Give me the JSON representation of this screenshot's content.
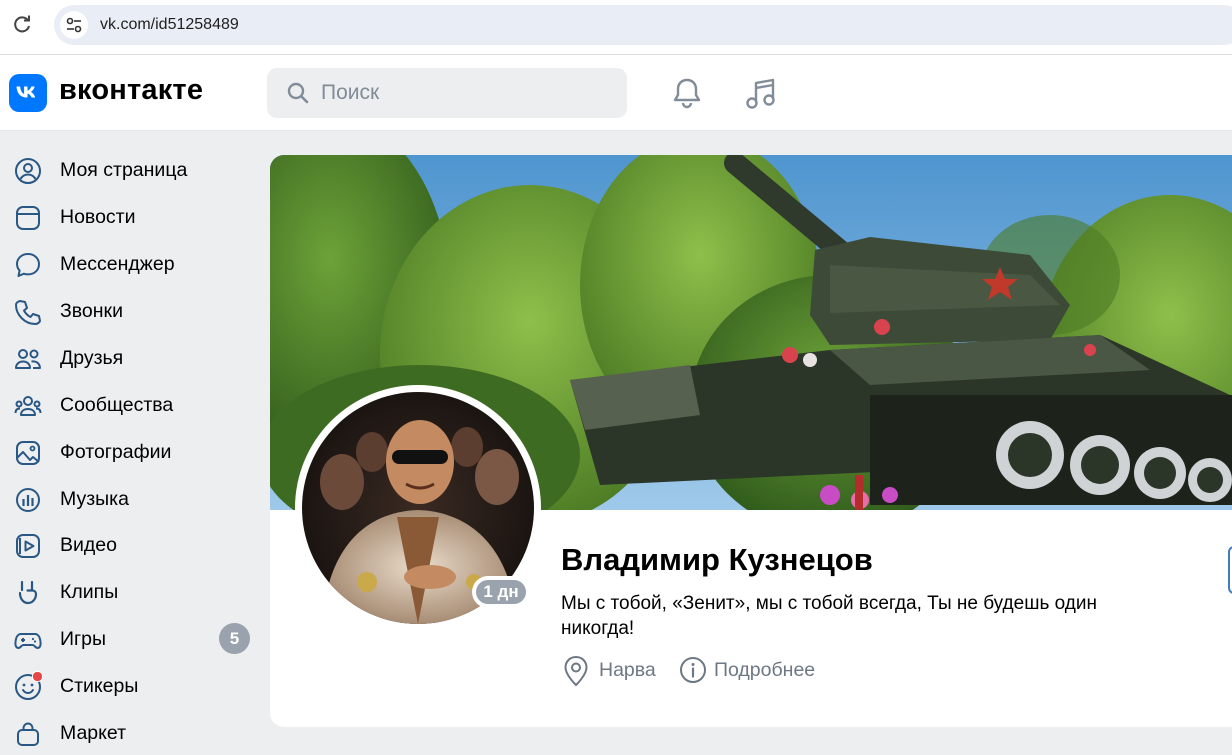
{
  "browser": {
    "url": "vk.com/id51258489"
  },
  "header": {
    "logo_icon": "vk-logo-icon",
    "wordmark": "вконтакте",
    "search_placeholder": "Поиск",
    "accent_color": "#0077ff"
  },
  "sidebar": {
    "items": [
      {
        "label": "Моя страница",
        "icon": "user-circle-icon"
      },
      {
        "label": "Новости",
        "icon": "news-icon"
      },
      {
        "label": "Мессенджер",
        "icon": "chat-bubble-icon"
      },
      {
        "label": "Звонки",
        "icon": "phone-icon"
      },
      {
        "label": "Друзья",
        "icon": "friends-icon"
      },
      {
        "label": "Сообщества",
        "icon": "communities-icon"
      },
      {
        "label": "Фотографии",
        "icon": "photo-icon"
      },
      {
        "label": "Музыка",
        "icon": "music-icon"
      },
      {
        "label": "Видео",
        "icon": "video-icon"
      },
      {
        "label": "Клипы",
        "icon": "clips-icon"
      },
      {
        "label": "Игры",
        "icon": "gamepad-icon",
        "badge": "5"
      },
      {
        "label": "Стикеры",
        "icon": "sticker-icon"
      },
      {
        "label": "Маркет",
        "icon": "market-bag-icon"
      }
    ]
  },
  "profile": {
    "name": "Владимир Кузнецов",
    "status": "Мы с тобой, «Зенит», мы с тобой всегда, Ты не будешь один никогда!",
    "online": "1 дн",
    "location": "Нарва",
    "more_label": "Подробнее"
  }
}
